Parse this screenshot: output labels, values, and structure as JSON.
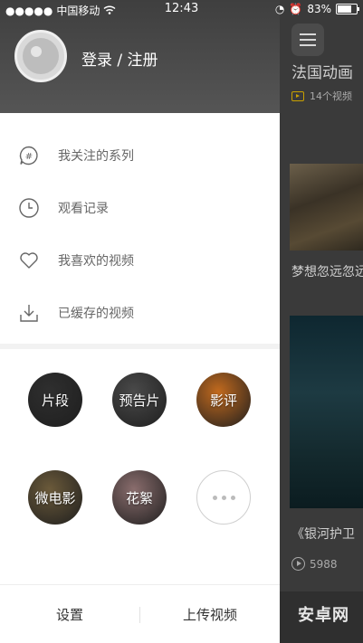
{
  "status_bar": {
    "carrier": "中国移动",
    "time": "12:43",
    "battery": "83%",
    "battery_level": 0.83
  },
  "drawer": {
    "login_label": "登录 / 注册",
    "menu": [
      {
        "label": "我关注的系列",
        "icon": "hashtag-icon"
      },
      {
        "label": "观看记录",
        "icon": "clock-icon"
      },
      {
        "label": "我喜欢的视频",
        "icon": "heart-icon"
      },
      {
        "label": "已缓存的视频",
        "icon": "download-icon"
      }
    ],
    "categories": [
      {
        "label": "片段",
        "color": "#2f2f2f"
      },
      {
        "label": "预告片",
        "color": "#4a4a4a"
      },
      {
        "label": "影评",
        "color": "#c26a1e"
      },
      {
        "label": "微电影",
        "color": "#6b5a3a"
      },
      {
        "label": "花絮",
        "color": "#8a6d6d"
      }
    ],
    "bottom": {
      "settings": "设置",
      "upload": "上传视频"
    }
  },
  "background": {
    "series_title": "法国动画",
    "video_count": "14个视频",
    "caption1": "梦想忽远忽远",
    "caption2": "《银河护卫",
    "plays": "5988",
    "watermark": "安卓网"
  },
  "colors": {
    "header_bg": "#4a4a4a",
    "accent_yellow": "#c9a100",
    "menu_text": "#666666"
  }
}
